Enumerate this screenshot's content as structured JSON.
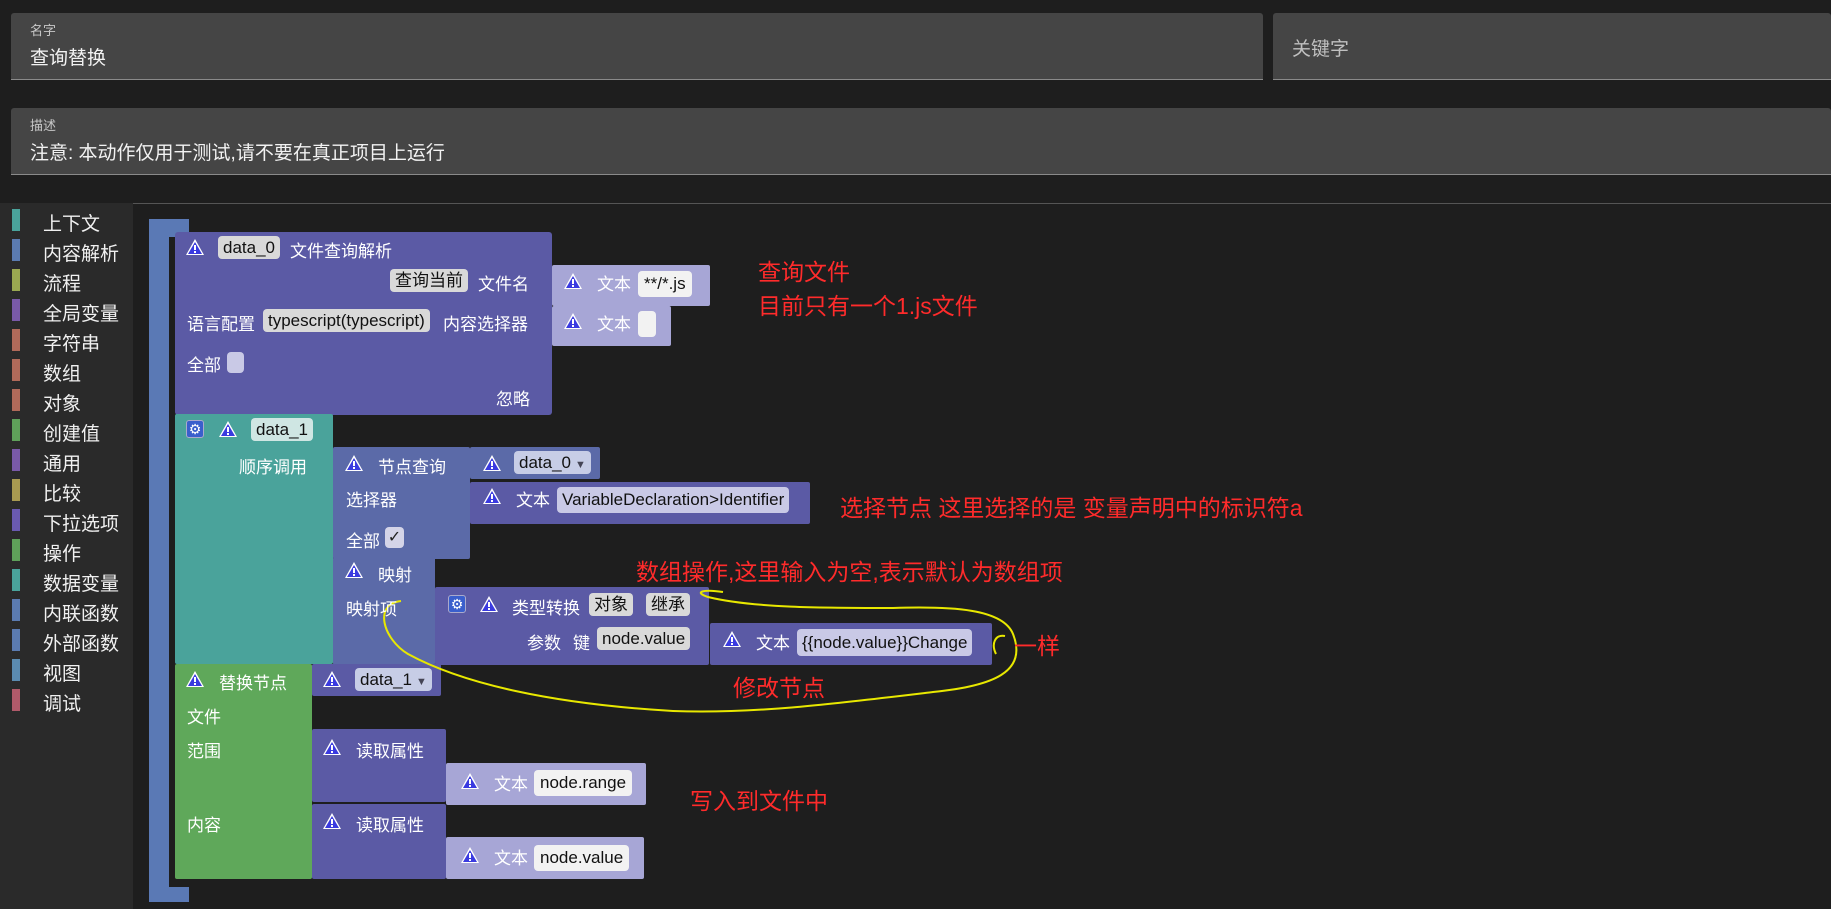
{
  "form": {
    "name_label": "名字",
    "name_value": "查询替换",
    "keyword_placeholder": "关键字",
    "desc_label": "描述",
    "desc_value": "注意: 本动作仅用于测试,请不要在真正项目上运行"
  },
  "toolbox": {
    "categories": [
      {
        "label": "上下文",
        "color": "#4aa39b"
      },
      {
        "label": "内容解析",
        "color": "#5b7bb0"
      },
      {
        "label": "流程",
        "color": "#9aa851"
      },
      {
        "label": "全局变量",
        "color": "#7a5aa8"
      },
      {
        "label": "字符串",
        "color": "#b06a5a"
      },
      {
        "label": "数组",
        "color": "#b06a5a"
      },
      {
        "label": "对象",
        "color": "#b06a5a"
      },
      {
        "label": "创建值",
        "color": "#5fa05a"
      },
      {
        "label": "通用",
        "color": "#7a5aa8"
      },
      {
        "label": "比较",
        "color": "#a89a51"
      },
      {
        "label": "下拉选项",
        "color": "#6a5ab0"
      },
      {
        "label": "操作",
        "color": "#5fa05a"
      },
      {
        "label": "数据变量",
        "color": "#4aa39b"
      },
      {
        "label": "内联函数",
        "color": "#5b7bb0"
      },
      {
        "label": "外部函数",
        "color": "#5b7bb0"
      },
      {
        "label": "视图",
        "color": "#5b8bb0"
      },
      {
        "label": "调试",
        "color": "#b05a6a"
      }
    ]
  },
  "blocks": {
    "parse": {
      "var": "data_0",
      "title": "文件查询解析",
      "scope": "查询当前",
      "filename_label": "文件名",
      "lang_label": "语言配置",
      "lang_value": "typescript(typescript)",
      "selector_label": "内容选择器",
      "all_label": "全部",
      "ignore_label": "忽略",
      "text_label": "文本",
      "filename_value": "**/*.js",
      "selector_value": ""
    },
    "data1": {
      "var": "data_1",
      "seq_label": "顺序调用"
    },
    "node_query": {
      "title": "节点查询",
      "ref": "data_0",
      "selector_label": "选择器",
      "text_label": "文本",
      "selector_value": "VariableDeclaration>Identifier",
      "all_label": "全部",
      "all_check": "✓"
    },
    "map": {
      "title": "映射",
      "item_label": "映射项"
    },
    "convert": {
      "title": "类型转换",
      "type": "对象",
      "mode": "继承",
      "param_label": "参数",
      "key_label": "键",
      "key_value": "node.value",
      "text_label": "文本",
      "text_value": "{{node.value}}Change"
    },
    "replace": {
      "title": "替换节点",
      "ref": "data_1",
      "file_label": "文件",
      "range_label": "范围",
      "content_label": "内容"
    },
    "read1": {
      "title": "读取属性",
      "text_label": "文本",
      "value": "node.range"
    },
    "read2": {
      "title": "读取属性",
      "text_label": "文本",
      "value": "node.value"
    }
  },
  "annotations": {
    "query_file": "查询文件",
    "only_one": "目前只有一个1.js文件",
    "select_node": "选择节点 这里选择的是 变量声明中的标识符a",
    "array_op": "数组操作,这里输入为空,表示默认为数组项",
    "same": "一样",
    "modify": "修改节点",
    "write": "写入到文件中"
  },
  "colors": {
    "block_purple": "#5b5aa5",
    "block_teal": "#4aa39b",
    "block_green": "#5fa85a",
    "text_block": "#a7a6d6",
    "annotation": "#ff2b2b",
    "scribble": "#e8e800"
  }
}
